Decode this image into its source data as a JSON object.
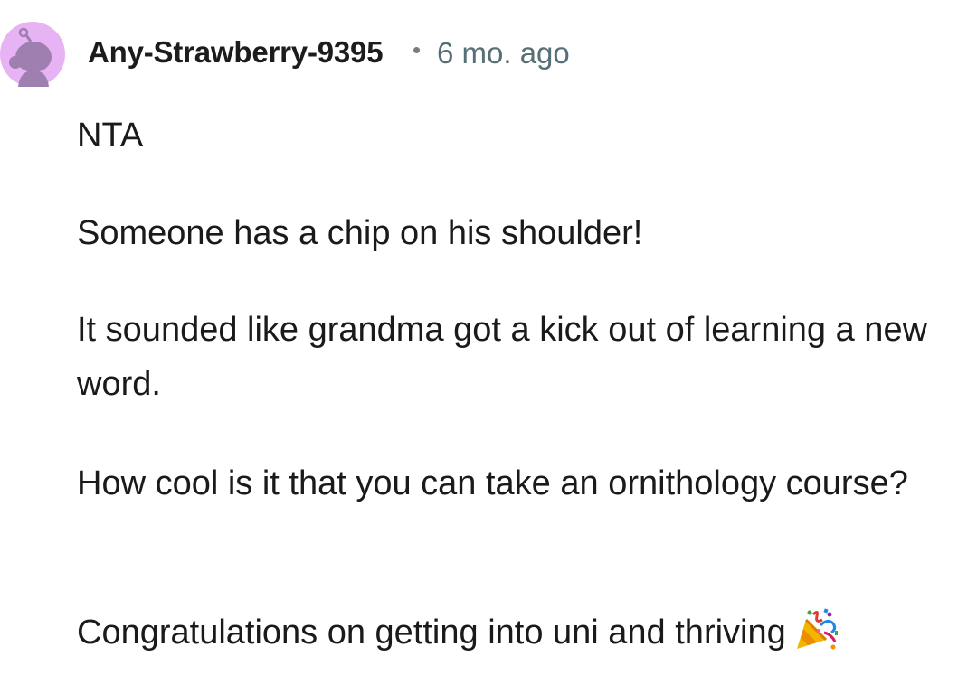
{
  "comment": {
    "username": "Any-Strawberry-9395",
    "separator": "•",
    "timestamp": "6 mo. ago",
    "paragraphs": [
      "NTA",
      "Someone has a chip on his shoulder!",
      "It sounded like grandma got a kick out of learning a new word.",
      "How cool is it that you can take an ornithology course?",
      "Congratulations on getting into uni and thriving"
    ],
    "emoji": "party-popper-icon"
  },
  "colors": {
    "avatar_bg": "#E8B3F5",
    "avatar_figure": "#9E7FB0",
    "username": "#1C1C1C",
    "timestamp": "#576F76",
    "text": "#1A1A1B"
  }
}
